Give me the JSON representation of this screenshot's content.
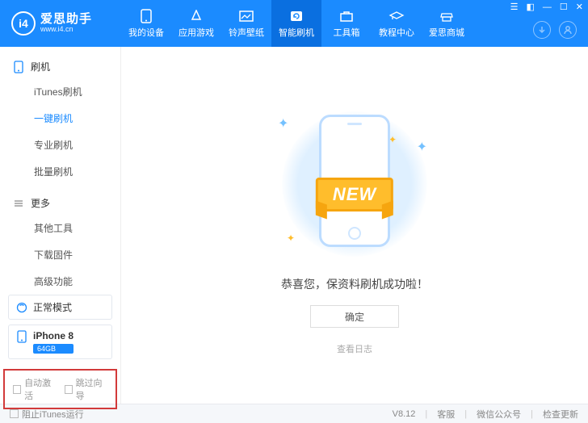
{
  "app": {
    "title": "爱思助手",
    "subtitle": "www.i4.cn",
    "logo_letters": "i4"
  },
  "nav": {
    "items": [
      {
        "label": "我的设备"
      },
      {
        "label": "应用游戏"
      },
      {
        "label": "铃声壁纸"
      },
      {
        "label": "智能刷机",
        "active": true
      },
      {
        "label": "工具箱"
      },
      {
        "label": "教程中心"
      },
      {
        "label": "爱思商城"
      }
    ]
  },
  "sidebar": {
    "section1": {
      "title": "刷机",
      "items": [
        {
          "label": "iTunes刷机"
        },
        {
          "label": "一键刷机",
          "active": true
        },
        {
          "label": "专业刷机"
        },
        {
          "label": "批量刷机"
        }
      ]
    },
    "section2": {
      "title": "更多",
      "items": [
        {
          "label": "其他工具"
        },
        {
          "label": "下载固件"
        },
        {
          "label": "高级功能"
        }
      ]
    },
    "mode": {
      "label": "正常模式"
    },
    "device": {
      "name": "iPhone 8",
      "storage": "64GB"
    },
    "options": {
      "auto_activate": "自动激活",
      "skip_guide": "跳过向导"
    }
  },
  "main": {
    "ribbon": "NEW",
    "success_text": "恭喜您，保资料刷机成功啦！",
    "ok_button": "确定",
    "log_link": "查看日志"
  },
  "footer": {
    "block_itunes": "阻止iTunes运行",
    "version": "V8.12",
    "support": "客服",
    "wechat": "微信公众号",
    "update": "检查更新"
  }
}
